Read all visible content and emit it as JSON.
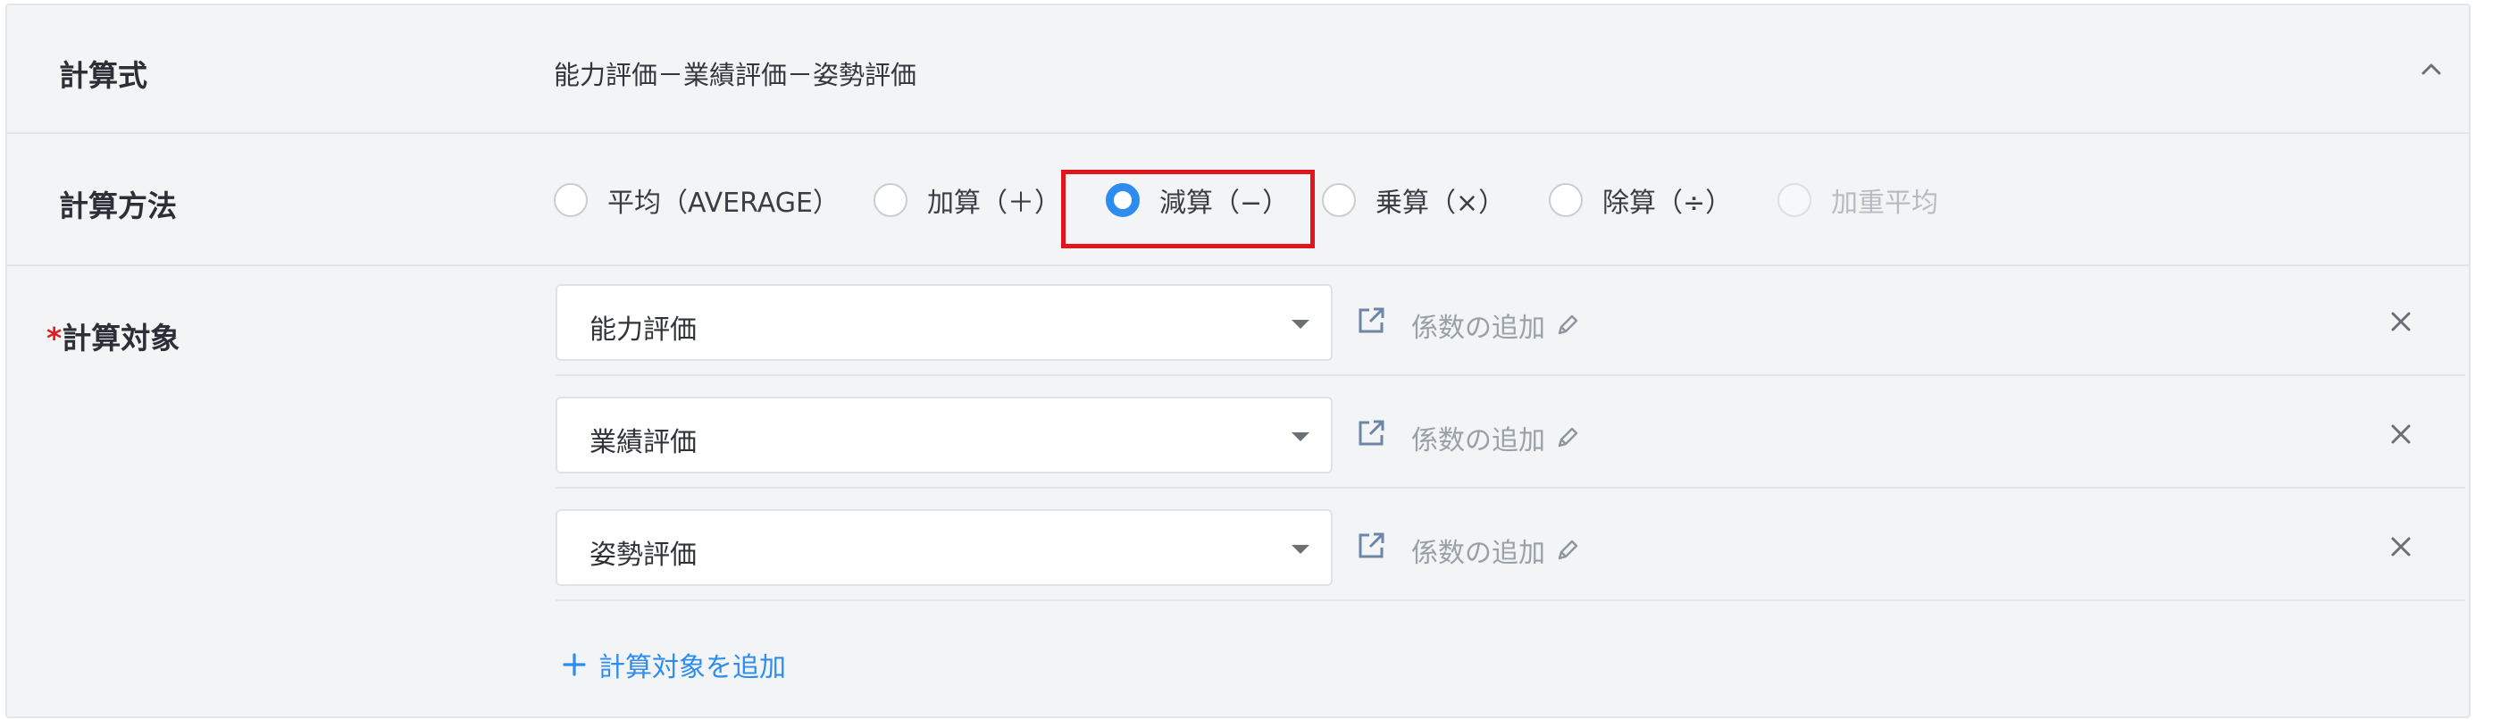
{
  "formula": {
    "label": "計算式",
    "value": "能力評価－業績評価－姿勢評価"
  },
  "method": {
    "label": "計算方法",
    "options": [
      {
        "label": "平均（AVERAGE）",
        "checked": false,
        "disabled": false
      },
      {
        "label": "加算（＋）",
        "checked": false,
        "disabled": false
      },
      {
        "label": "減算（−）",
        "checked": true,
        "disabled": false
      },
      {
        "label": "乗算（×）",
        "checked": false,
        "disabled": false
      },
      {
        "label": "除算（÷）",
        "checked": false,
        "disabled": false
      },
      {
        "label": "加重平均",
        "checked": false,
        "disabled": true
      }
    ]
  },
  "targets": {
    "required_mark": "*",
    "label": "計算対象",
    "rows": [
      {
        "value": "能力評価",
        "coef_label": "係数の追加"
      },
      {
        "value": "業績評価",
        "coef_label": "係数の追加"
      },
      {
        "value": "姿勢評価",
        "coef_label": "係数の追加"
      }
    ],
    "add_label": "計算対象を追加"
  },
  "colors": {
    "accent": "#2d8cf0",
    "highlight": "#e0161a",
    "required": "#e02020"
  }
}
